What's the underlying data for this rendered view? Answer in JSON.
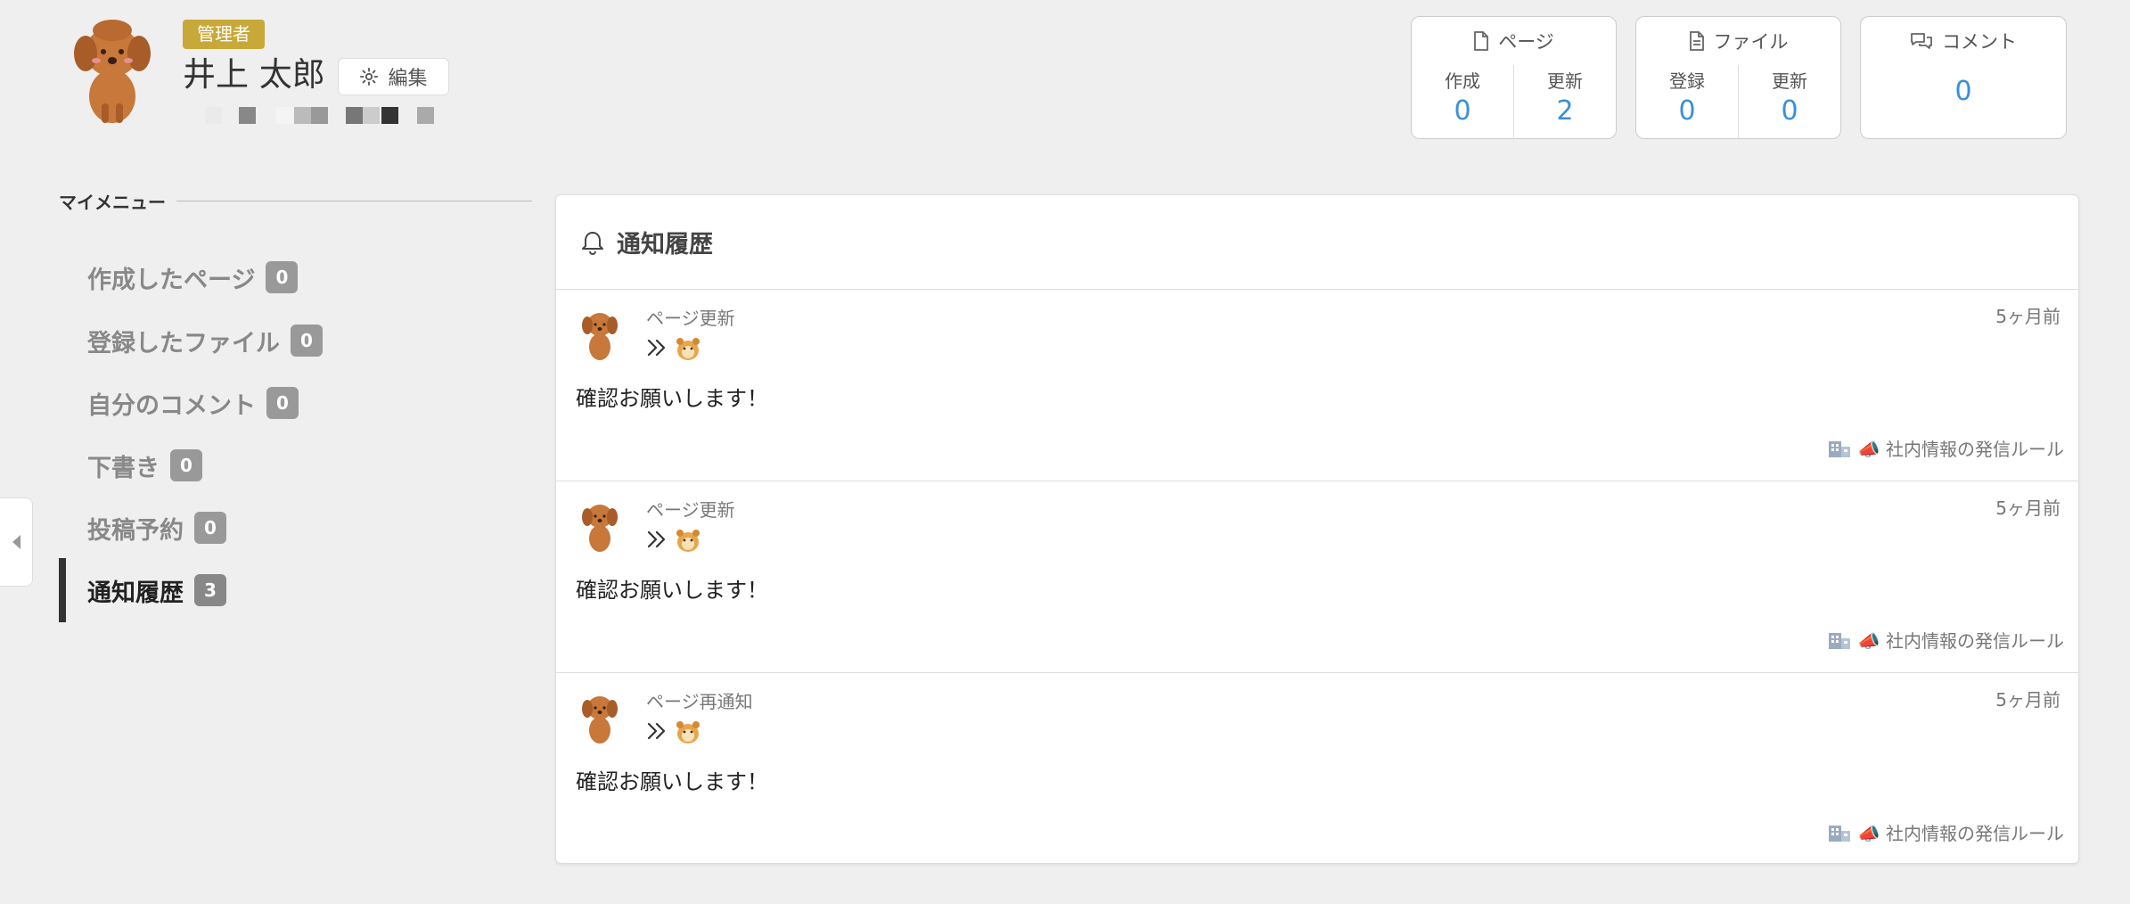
{
  "profile": {
    "role_badge": "管理者",
    "name": "井上 太郎",
    "edit_label": "編集",
    "avatar_icon": "dog-avatar-icon"
  },
  "stats": {
    "page": {
      "title": "ページ",
      "icon": "file-icon",
      "created_label": "作成",
      "created_value": "0",
      "updated_label": "更新",
      "updated_value": "2"
    },
    "file": {
      "title": "ファイル",
      "icon": "file-text-icon",
      "registered_label": "登録",
      "registered_value": "0",
      "updated_label": "更新",
      "updated_value": "0"
    },
    "comment": {
      "title": "コメント",
      "icon": "comments-icon",
      "value": "0"
    },
    "accent_color": "#3a8fd8"
  },
  "sidebar": {
    "heading": "マイメニュー",
    "items": [
      {
        "label": "作成したページ",
        "count": "0",
        "active": false
      },
      {
        "label": "登録したファイル",
        "count": "0",
        "active": false
      },
      {
        "label": "自分のコメント",
        "count": "0",
        "active": false
      },
      {
        "label": "下書き",
        "count": "0",
        "active": false
      },
      {
        "label": "投稿予約",
        "count": "0",
        "active": false
      },
      {
        "label": "通知履歴",
        "count": "3",
        "active": true
      }
    ]
  },
  "main": {
    "title": "通知履歴",
    "title_icon": "bell-icon",
    "notifications": [
      {
        "type": "ページ更新",
        "time": "5ヶ月前",
        "comment": "確認お願いします！",
        "page": "📣 社内情報の発信ルール"
      },
      {
        "type": "ページ更新",
        "time": "5ヶ月前",
        "comment": "確認お願いします！",
        "page": "📣 社内情報の発信ルール"
      },
      {
        "type": "ページ再通知",
        "time": "5ヶ月前",
        "comment": "確認お願いします！",
        "page": "📣 社内情報の発信ルール"
      }
    ]
  },
  "colors": {
    "background": "#efefef",
    "badge": "#c8a838",
    "count_badge": "#999999",
    "link_blue": "#3a8fd8"
  }
}
